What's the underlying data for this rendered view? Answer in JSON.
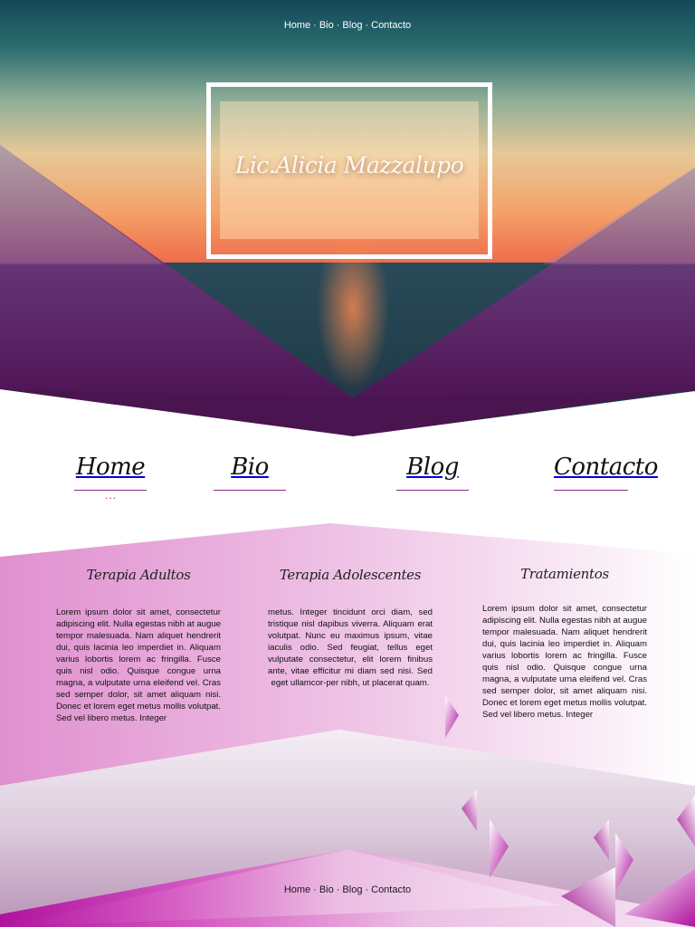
{
  "top_nav": {
    "items": [
      "Home",
      "Bio",
      "Blog",
      "Contacto"
    ],
    "separator": "·"
  },
  "hero": {
    "title": "Lic.Alicia Mazzalupo"
  },
  "script_nav": {
    "items": [
      "Home",
      "Bio",
      "Blog",
      "Contacto"
    ],
    "active_marker": "..."
  },
  "columns": [
    {
      "title": "Terapia Adultos",
      "body": "Lorem ipsum dolor sit amet, consectetur adipiscing elit. Nulla egestas nibh at augue tempor malesuada. Nam aliquet hendrerit dui, quis lacinia leo imperdiet in. Aliquam varius lobortis lorem ac fringilla. Fusce quis nisl odio. Quisque congue urna magna, a vulputate urna eleifend vel. Cras sed semper dolor, sit amet aliquam nisi. Donec et lorem eget metus mollis volutpat. Sed vel libero metus. Integer"
    },
    {
      "title": "Terapia Adolescentes",
      "body": "metus. Integer tincidunt orci diam, sed tristique nisl dapibus viverra. Aliquam erat volutpat. Nunc eu maximus ipsum, vitae iaculis odio. Sed feugiat, tellus eget vulputate consectetur, elit lorem finibus ante, vitae efficitur mi diam sed nisi. Sed eget ullamcor-per nibh, ut placerat quam."
    },
    {
      "title": "Tratamientos",
      "body": "Lorem ipsum dolor sit amet, consectetur adipiscing elit. Nulla egestas nibh at augue tempor malesuada. Nam aliquet hendrerit dui, quis lacinia leo imperdiet in. Aliquam varius lobortis lorem ac fringilla. Fusce quis nisl odio. Quisque congue urna magna, a vulputate urna eleifend vel. Cras sed semper dolor, sit amet aliquam nisi. Donec et lorem eget metus mollis volutpat. Sed vel libero metus. Integer"
    }
  ],
  "bottom_nav": {
    "items": [
      "Home",
      "Bio",
      "Blog",
      "Contacto"
    ],
    "separator": "·"
  },
  "colors": {
    "accent": "#b0246f",
    "magenta": "#c026a8",
    "deep_purple": "#5a1a5e",
    "teal": "#1d5a62"
  }
}
